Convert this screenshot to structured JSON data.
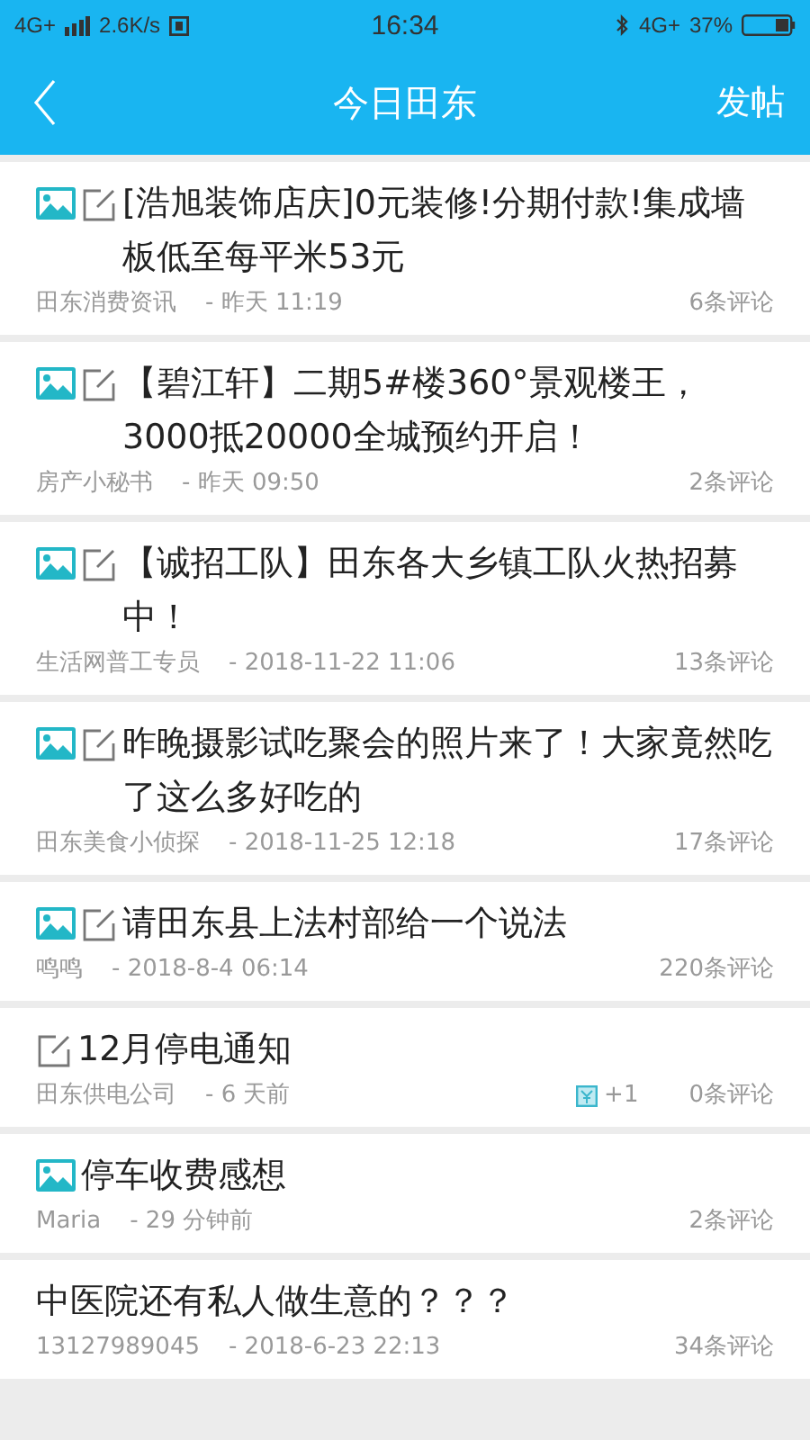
{
  "status_bar": {
    "network_left": "4G+",
    "speed": "2.6K/s",
    "time": "16:34",
    "network_right": "4G+",
    "battery": "37%"
  },
  "header": {
    "title": "今日田东",
    "action": "发帖"
  },
  "posts": [
    {
      "has_image": true,
      "has_edit": true,
      "title": "[浩旭装饰店庆]0元装修!分期付款!集成墙板低至每平米53元",
      "author": "田东消费资讯",
      "time": "- 昨天 11:19",
      "comments": "6条评论"
    },
    {
      "has_image": true,
      "has_edit": true,
      "title": "【碧江轩】二期5#楼360°景观楼王，3000抵20000全城预约开启！",
      "author": "房产小秘书",
      "time": "- 昨天 09:50",
      "comments": "2条评论"
    },
    {
      "has_image": true,
      "has_edit": true,
      "title": "【诚招工队】田东各大乡镇工队火热招募中！",
      "author": "生活网普工专员",
      "time": "- 2018-11-22 11:06",
      "comments": "13条评论"
    },
    {
      "has_image": true,
      "has_edit": true,
      "title": "昨晚摄影试吃聚会的照片来了！大家竟然吃了这么多好吃的",
      "author": "田东美食小侦探",
      "time": "- 2018-11-25 12:18",
      "comments": "17条评论"
    },
    {
      "has_image": true,
      "has_edit": true,
      "title": "请田东县上法村部给一个说法",
      "author": "鸣鸣",
      "time": "- 2018-8-4 06:14",
      "comments": "220条评论"
    },
    {
      "has_image": false,
      "has_edit": true,
      "title": "12月停电通知",
      "author": "田东供电公司",
      "time": "- 6 天前",
      "reward": "+1",
      "comments": "0条评论"
    },
    {
      "has_image": true,
      "has_edit": false,
      "title": "停车收费感想",
      "author": "Maria",
      "time": "- 29 分钟前",
      "comments": "2条评论"
    },
    {
      "has_image": false,
      "has_edit": false,
      "title": "中医院还有私人做生意的？？？",
      "author": "13127989045",
      "time": "- 2018-6-23 22:13",
      "comments": "34条评论"
    }
  ]
}
